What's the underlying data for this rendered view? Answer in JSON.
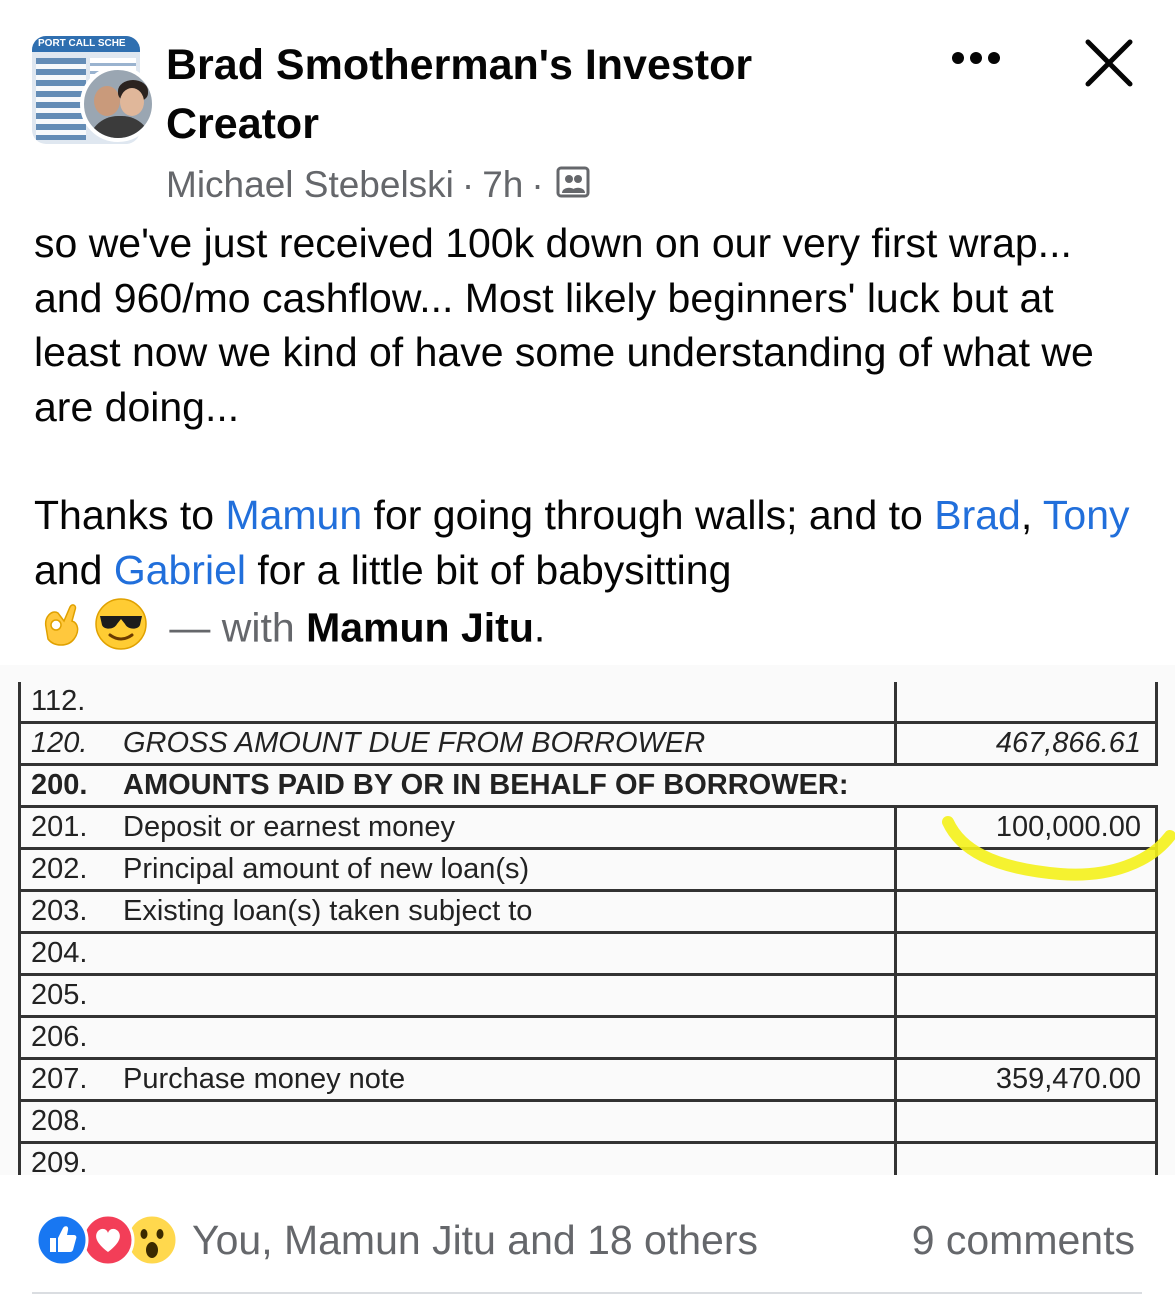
{
  "post": {
    "group_name": "Brad Smotherman's Investor Creator",
    "group_avatar_text": "PORT CALL SCHE",
    "author": "Michael Stebelski",
    "time": "7h",
    "dot": "·",
    "text": {
      "paragraph1": "so we've just received 100k down on our very first wrap... and 960/mo cashflow... Most likely beginners' luck but at least now we kind of have some understanding of what we are doing...",
      "thanks_prefix": "Thanks to ",
      "mention_mamun": "Mamun",
      "thanks_middle": " for going through walls; and to ",
      "mention_brad": "Brad",
      "comma": ", ",
      "mention_tony": "Tony",
      "and": " and ",
      "mention_gabriel": "Gabriel",
      "thanks_suffix": " for a little bit of babysitting",
      "with_text": " — with ",
      "tagged": "Mamun Jitu",
      "period": "."
    }
  },
  "document": {
    "rows": [
      {
        "num": "112.",
        "desc": "",
        "amount": ""
      },
      {
        "num": "120.",
        "desc": "GROSS AMOUNT DUE FROM BORROWER",
        "amount": "467,866.61"
      },
      {
        "num": "200.",
        "desc": "AMOUNTS PAID BY OR IN BEHALF OF BORROWER:",
        "amount": ""
      },
      {
        "num": "201.",
        "desc": "Deposit or earnest money",
        "amount": "100,000.00"
      },
      {
        "num": "202.",
        "desc": "Principal amount of new loan(s)",
        "amount": ""
      },
      {
        "num": "203.",
        "desc": "Existing loan(s) taken subject to",
        "amount": ""
      },
      {
        "num": "204.",
        "desc": "",
        "amount": ""
      },
      {
        "num": "205.",
        "desc": "",
        "amount": ""
      },
      {
        "num": "206.",
        "desc": "",
        "amount": ""
      },
      {
        "num": "207.",
        "desc": "Purchase money note",
        "amount": "359,470.00"
      },
      {
        "num": "208.",
        "desc": "",
        "amount": ""
      },
      {
        "num": "209.",
        "desc": "",
        "amount": ""
      }
    ]
  },
  "reactions": {
    "icons": [
      "like-icon",
      "love-icon",
      "wow-icon"
    ],
    "summary": "You, Mamun Jitu and 18 others",
    "comments": "9 comments"
  },
  "colors": {
    "link": "#216fdb",
    "like": "#1877f2",
    "love": "#f33e58",
    "highlight": "#f4f11a"
  }
}
